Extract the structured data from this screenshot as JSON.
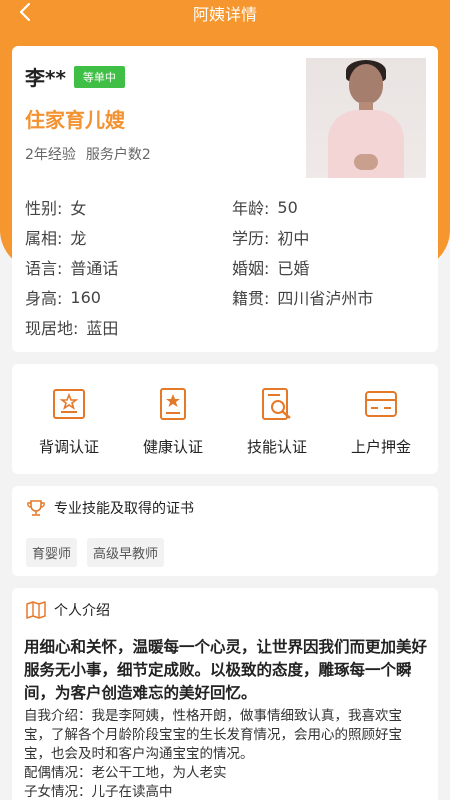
{
  "header": {
    "title": "阿姨详情"
  },
  "profile": {
    "name": "李**",
    "status_badge": "等单中",
    "job_title": "住家育儿嫂",
    "experience": "2年经验",
    "households": "服务户数2",
    "left_fields": [
      {
        "label": "性别:",
        "value": "女"
      },
      {
        "label": "属相:",
        "value": "龙"
      },
      {
        "label": "语言:",
        "value": "普通话"
      },
      {
        "label": "身高:",
        "value": "160"
      },
      {
        "label": "现居地:",
        "value": "蓝田"
      }
    ],
    "right_fields": [
      {
        "label": "年龄:",
        "value": "50"
      },
      {
        "label": "学历:",
        "value": "初中"
      },
      {
        "label": "婚姻:",
        "value": "已婚"
      },
      {
        "label": "籍贯:",
        "value": "四川省泸州市"
      }
    ]
  },
  "certifications": [
    {
      "label": "背调认证",
      "icon": "certificate-icon"
    },
    {
      "label": "健康认证",
      "icon": "health-card-icon"
    },
    {
      "label": "技能认证",
      "icon": "skill-search-icon"
    },
    {
      "label": "上户押金",
      "icon": "deposit-card-icon"
    }
  ],
  "skills": {
    "title": "专业技能及取得的证书",
    "tags": [
      "育婴师",
      "高级早教师"
    ]
  },
  "intro": {
    "title": "个人介绍",
    "headline": "用细心和关怀，温暖每一个心灵，让世界因我们而更加美好服务无小事，细节定成败。以极致的态度，雕琢每一个瞬间，为客户创造难忘的美好回忆。",
    "self_intro": " 自我介绍：我是李阿姨，性格开朗，做事情细致认真，我喜欢宝宝，了解各个月龄阶段宝宝的生长发育情况，会用心的照顾好宝宝，也会及时和客户沟通宝宝的情况。",
    "spouse": "配偶情况：老公干工地，为人老实",
    "children": "子女情况：儿子在读高中"
  },
  "colors": {
    "brand": "#f5962e",
    "accent_text": "#f29231",
    "badge": "#3fbf46"
  }
}
